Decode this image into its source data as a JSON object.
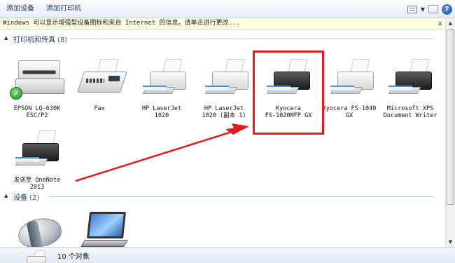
{
  "toolbar": {
    "add_device": "添加设备",
    "add_printer": "添加打印机",
    "view_icon": "view-options-icon",
    "help_icon": "help-icon"
  },
  "infobar": {
    "text": "Windows 可以显示增强型设备图标和来自 Internet 的信息。请单击进行更改..."
  },
  "sections": {
    "printers": {
      "title": "打印机和传真",
      "count": "(8)"
    },
    "devices": {
      "title": "设备",
      "count": "(2)"
    }
  },
  "printers": [
    {
      "label": "EPSON LQ-630K\nESC/P2",
      "icon": "epson-printer-icon",
      "default": true
    },
    {
      "label": "Fax",
      "icon": "fax-icon"
    },
    {
      "label": "HP LaserJet\n1020",
      "icon": "printer-icon"
    },
    {
      "label": "HP LaserJet\n1020 (副本 1)",
      "icon": "printer-icon"
    },
    {
      "label": "Kyocera\nFS-1020MFP GX",
      "icon": "printer-icon"
    },
    {
      "label": "Kyocera FS-1040\nGX",
      "icon": "printer-icon"
    },
    {
      "label": "Microsoft XPS\nDocument Writer",
      "icon": "printer-icon"
    },
    {
      "label": "发送至 OneNote\n2013",
      "icon": "printer-icon"
    }
  ],
  "devices": [
    {
      "icon": "mouse-icon"
    },
    {
      "icon": "laptop-icon"
    }
  ],
  "status": {
    "count_text": "10 个对象"
  },
  "colors": {
    "annotation": "#e21b1b",
    "link": "#1e395b",
    "infobar_bg": "#ffffe1"
  }
}
